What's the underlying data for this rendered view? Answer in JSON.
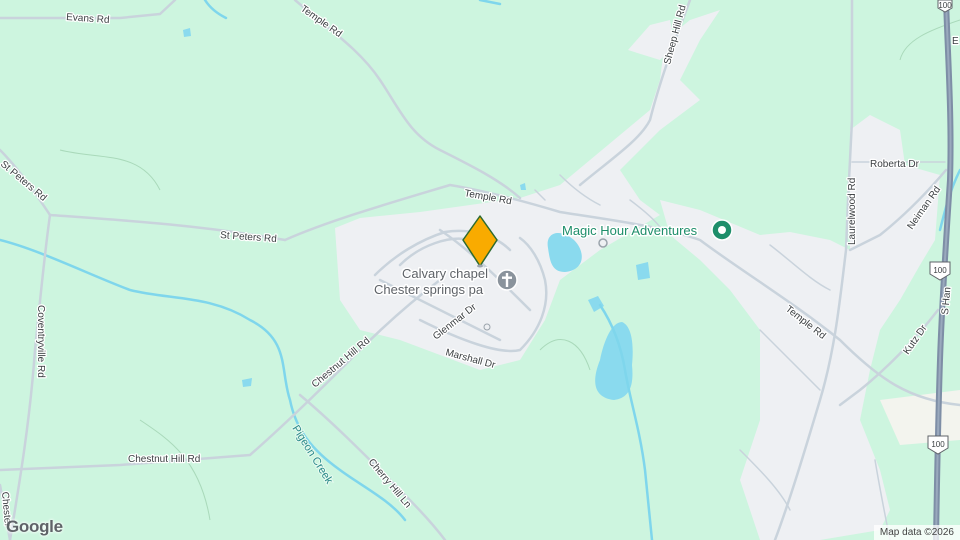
{
  "colors": {
    "land": "#cdf5df",
    "developed": "#eef0f3",
    "water": "#8adaee",
    "road": "#c9d3dc",
    "highway": "#7e8ea6",
    "pin": "#f9ab00",
    "poi_green": "#1e8e6a",
    "poi_gray": "#8a939c"
  },
  "roads": {
    "evans": "Evans Rd",
    "temple_top": "Temple Rd",
    "temple_mid": "Temple Rd",
    "temple_right": "Temple Rd",
    "sheep_hill": "Sheep Hill Rd",
    "st_peters_left": "St Peters Rd",
    "st_peters": "St Peters Rd",
    "coventryville": "Coventryville Rd",
    "glenmar": "Glenmar Dr",
    "marshall": "Marshall Dr",
    "chestnut_hill_rd": "Chestnut Hill Rd",
    "chestnut_hill_rd2": "Chestnut Hill Rd",
    "cherry_hill": "Cherry Hill Ln",
    "chester_partial": "Chester",
    "roberta": "Roberta Dr",
    "laurelwood": "Laurelwood Rd",
    "neiman": "Neiman Rd",
    "kutz": "Kutz Dr",
    "s_hanover_partial": "S Han",
    "e_partial": "E"
  },
  "water_label": "Pigeon Creek",
  "pois": {
    "church_line1": "Calvary chapel",
    "church_line2": "Chester springs pa",
    "church_icon": "cross-icon",
    "magic_hour": "Magic Hour Adventures",
    "magic_hour_icon": "poi-pin-icon"
  },
  "shields": {
    "top": "100",
    "middle": "100",
    "bottom": "100"
  },
  "google_logo": "Google",
  "attribution": "Map data ©2026"
}
